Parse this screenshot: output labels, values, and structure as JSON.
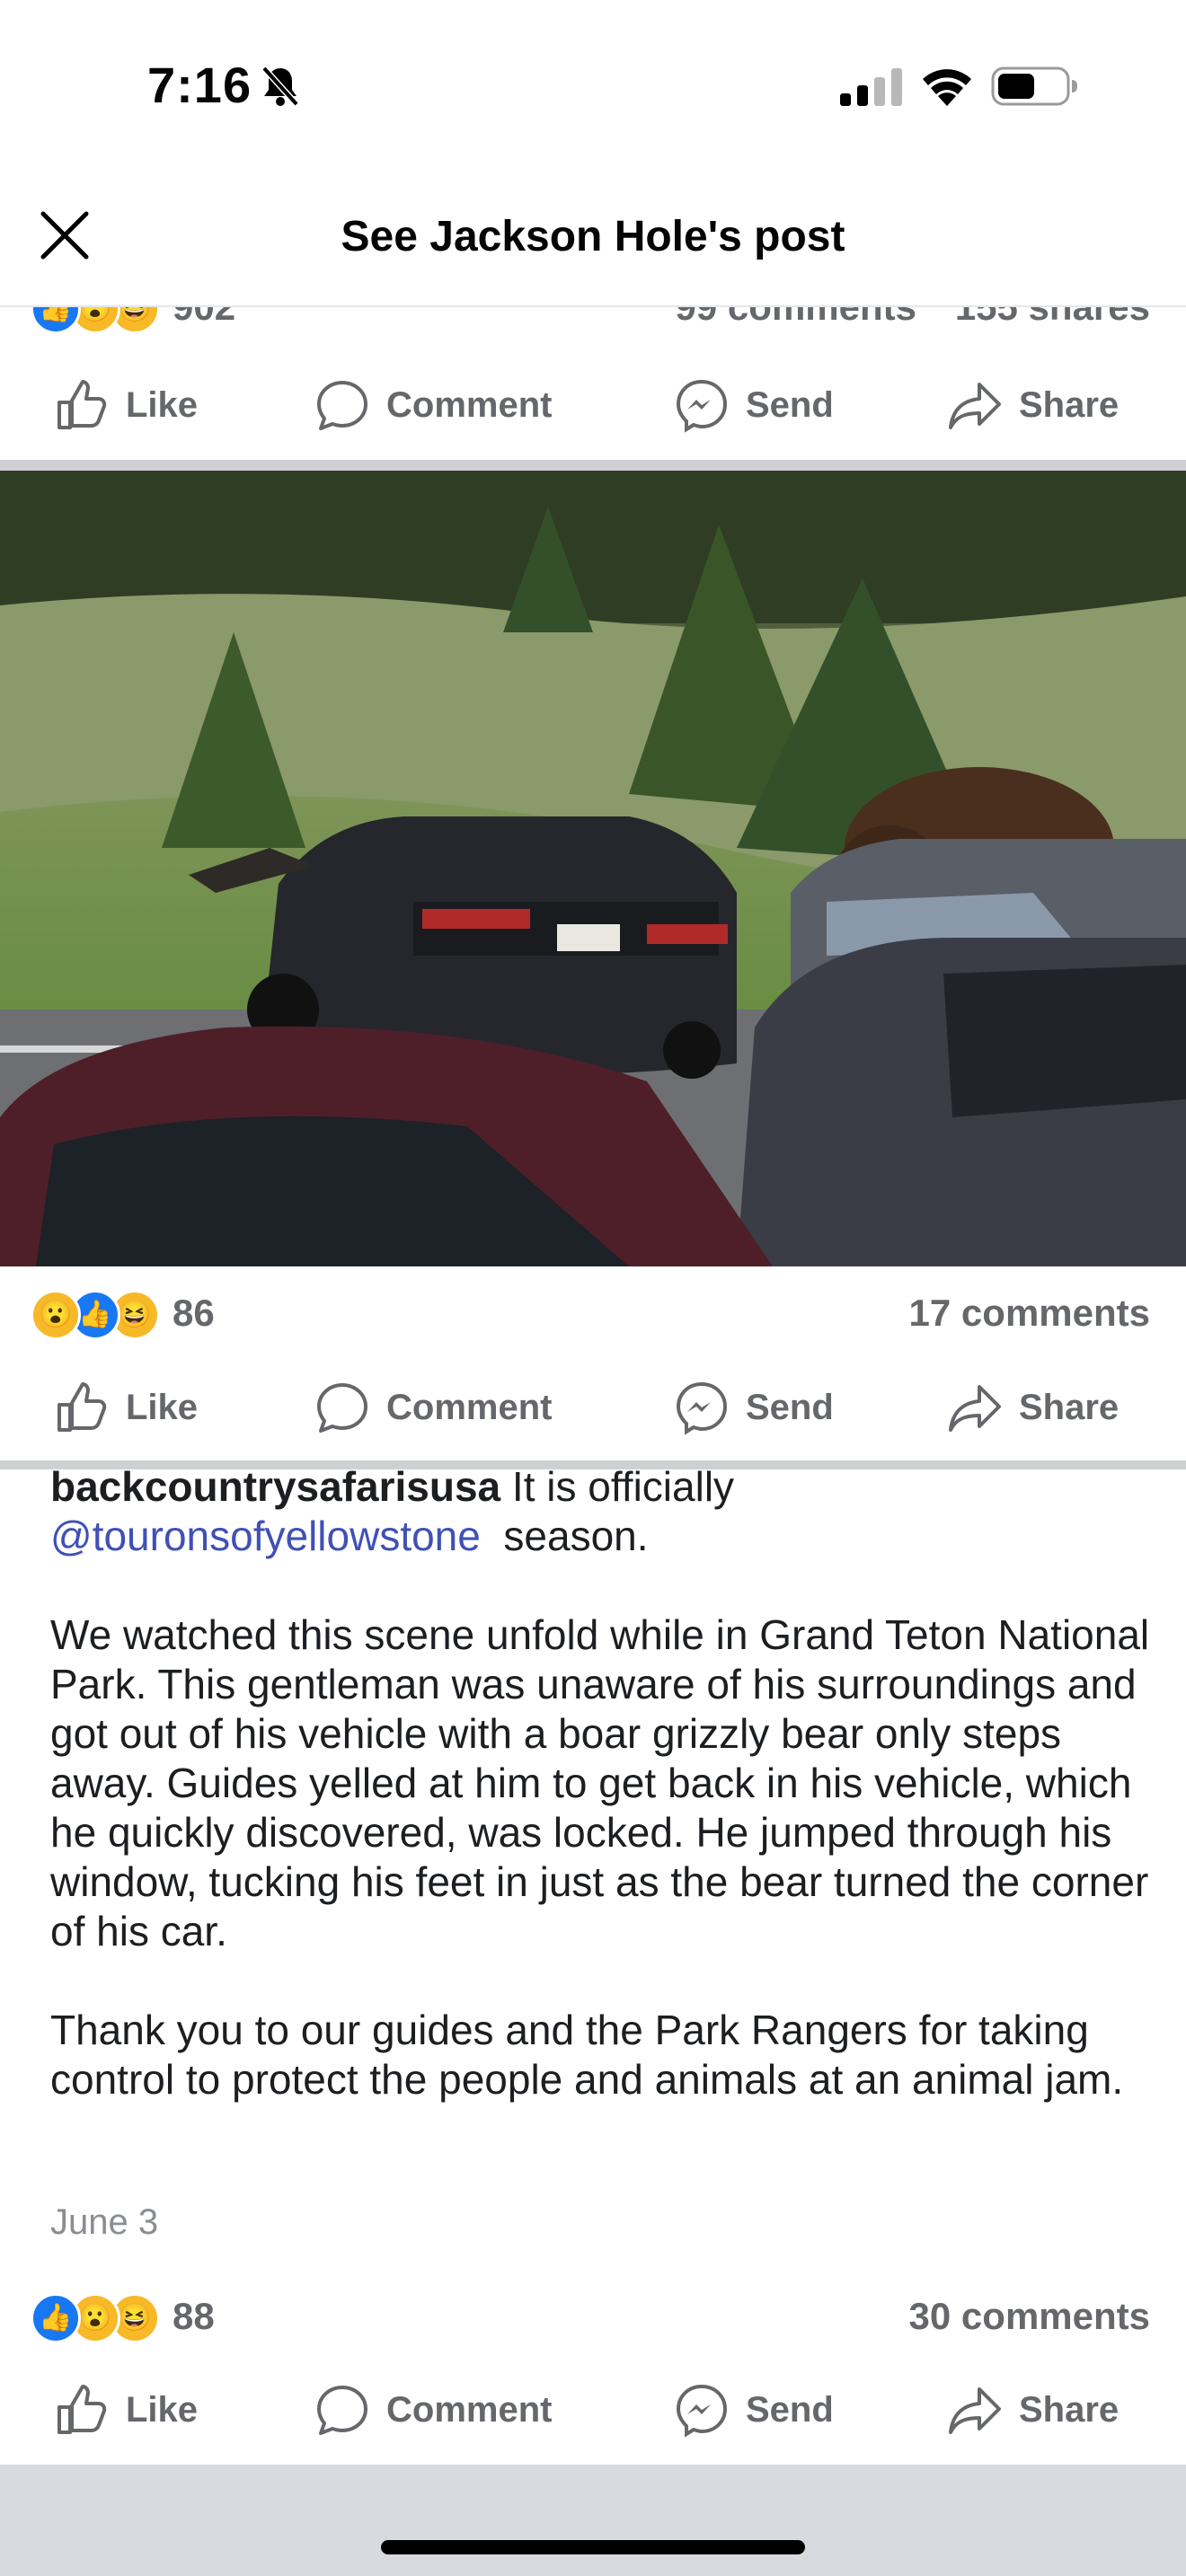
{
  "status_bar": {
    "time": "7:16"
  },
  "header": {
    "title": "See Jackson Hole's post"
  },
  "previous_post": {
    "reaction_count": "902",
    "comments": "99 comments",
    "shares": "155 shares"
  },
  "photo_post": {
    "reaction_count": "86",
    "comments": "17 comments"
  },
  "caption_post": {
    "username": "backcountrysafarisusa",
    "intro_text": " It is officially",
    "mention": "@touronsofyellowstone",
    "intro_suffix": " season.",
    "paragraph_1": "We watched this scene unfold while in Grand Teton National Park. This gentleman was unaware of his surroundings and got out of his vehicle with a boar grizzly bear only steps away. Guides yelled at him to get back in his vehicle, which he quickly discovered, was locked. He jumped through his window, tucking his feet in just as the bear turned the corner of his car.",
    "paragraph_2": "Thank you to our guides and the Park Rangers for taking control to protect the people and animals at an animal jam.",
    "date": "June 3",
    "reaction_count": "88",
    "comments": "30 comments"
  },
  "actions": {
    "like": "Like",
    "comment": "Comment",
    "send": "Send",
    "share": "Share"
  },
  "icons": {
    "reactions": [
      "like-emoji-icon",
      "wow-emoji-icon",
      "haha-emoji-icon"
    ],
    "like_glyph": "👍",
    "wow_glyph": "😮",
    "haha_glyph": "😆"
  },
  "colors": {
    "accent": "#1877f2",
    "mention": "#3f51b5",
    "muted": "#65676b",
    "divider": "#ced0d4"
  }
}
